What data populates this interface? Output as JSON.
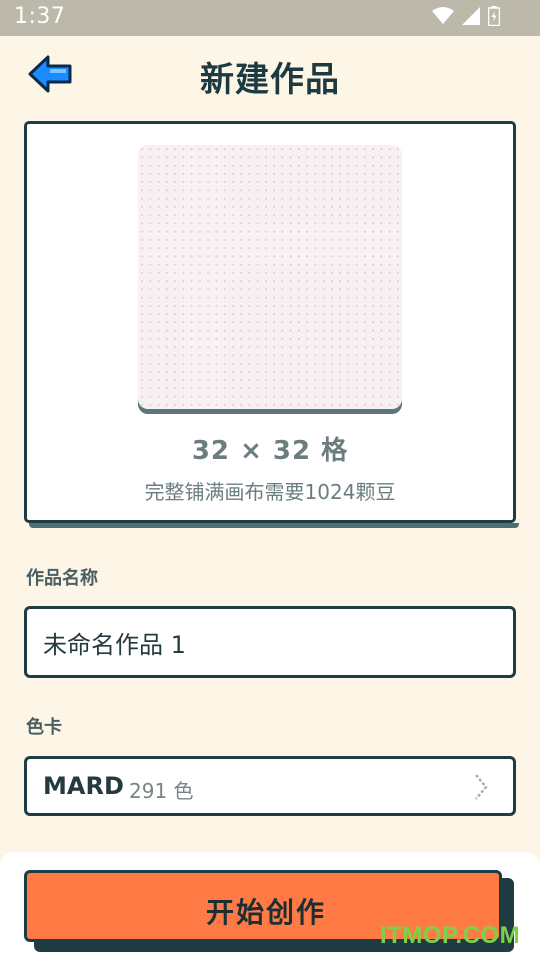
{
  "status_bar": {
    "time": "1:37"
  },
  "header": {
    "title": "新建作品"
  },
  "preview": {
    "grid_size": "32 × 32 格",
    "hint": "完整铺满画布需要1024颗豆"
  },
  "form": {
    "name_label": "作品名称",
    "name_value": "未命名作品 1",
    "palette_label": "色卡",
    "palette_name": "MARD",
    "palette_count": "291 色"
  },
  "actions": {
    "start_label": "开始创作"
  },
  "watermark": "ITMOP.COM",
  "colors": {
    "background": "#fdf6e7",
    "accent": "#ff7a45",
    "border": "#1e3c42",
    "back_arrow": "#1a8cff"
  }
}
